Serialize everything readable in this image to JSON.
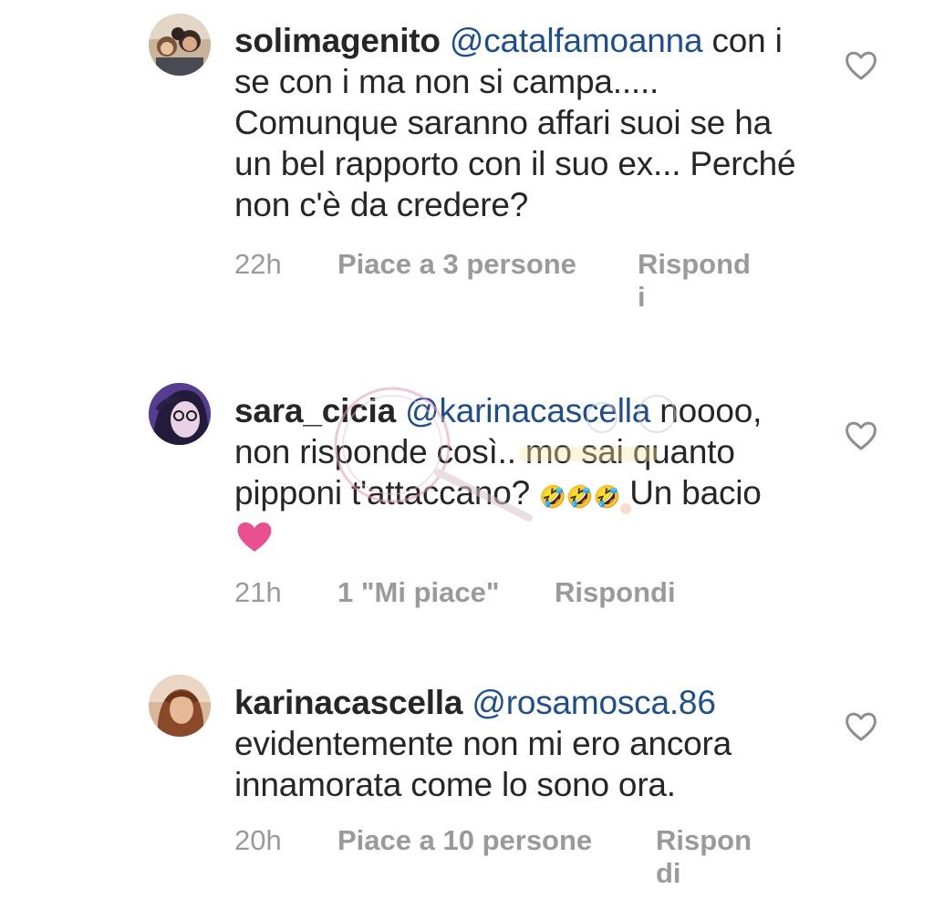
{
  "comments": [
    {
      "username": "solimagenito",
      "mention": "@catalfamoanna",
      "text": "con i se con i ma non si campa..... Comunque saranno affari suoi se ha un bel rapporto con il suo ex... Perché non c'è da credere?",
      "time": "22h",
      "likes": "Piace a 3 persone",
      "reply_line1": "Rispond",
      "reply_line2": "i"
    },
    {
      "username": "sara_cicia",
      "mention": "@karinacascella",
      "text_a": "noooo, non risponde così.. mo sai quanto pipponi t'attaccano?",
      "emoji_row": "🤣🤣🤣",
      "text_b": "Un bacio",
      "time": "21h",
      "likes": "1 \"Mi piace\"",
      "reply_line1": "Rispondi",
      "reply_line2": ""
    },
    {
      "username": "karinacascella",
      "mention": "@rosamosca.86",
      "text": "evidentemente non mi ero ancora innamorata come lo sono ora.",
      "time": "20h",
      "likes": "Piace a 10 persone",
      "reply_line1": "Rispon",
      "reply_line2": "di"
    }
  ],
  "colors": {
    "text": "#262626",
    "mention": "#1f4e8c",
    "meta": "#9a9a9a",
    "heart_emoji": "#e8508f"
  },
  "icons": {
    "like": "heart-outline-icon",
    "emoji_heart": "pink-heart-emoji"
  }
}
